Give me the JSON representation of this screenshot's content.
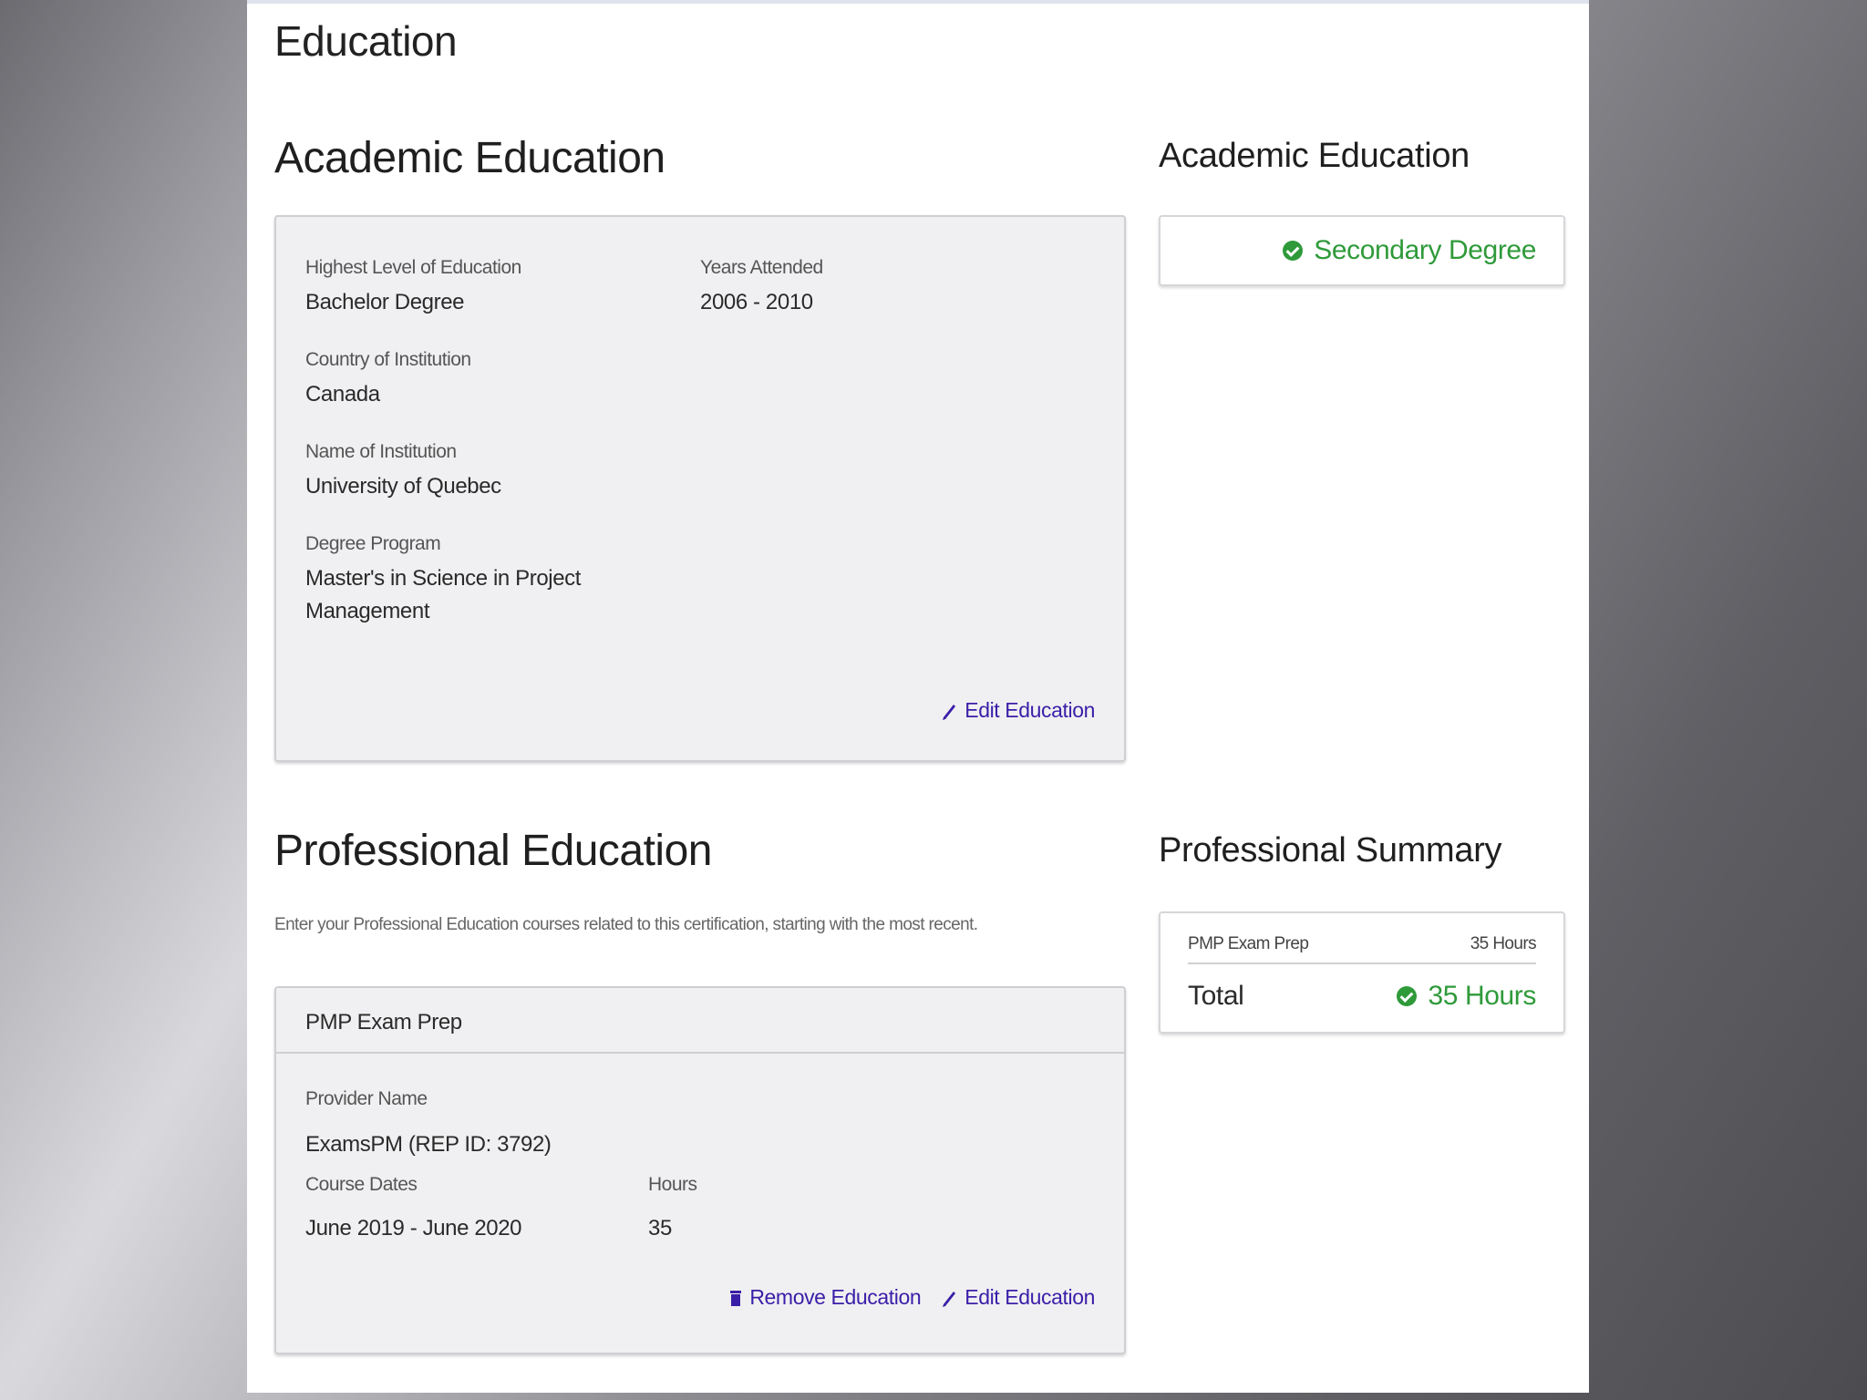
{
  "page": {
    "title": "Education"
  },
  "academic": {
    "heading": "Academic Education",
    "fields": {
      "highest_level_label": "Highest Level of Education",
      "highest_level_value": "Bachelor Degree",
      "years_label": "Years Attended",
      "years_value": "2006 - 2010",
      "country_label": "Country of Institution",
      "country_value": "Canada",
      "institution_label": "Name of Institution",
      "institution_value": "University of Quebec",
      "degree_label": "Degree Program",
      "degree_value_line1": "Master's in Science in Project",
      "degree_value_line2": "Management"
    },
    "edit_label": "Edit Education"
  },
  "academic_summary": {
    "heading": "Academic Education",
    "status": "Secondary Degree"
  },
  "professional": {
    "heading": "Professional Education",
    "description": "Enter your Professional Education courses related to this certification, starting with the most recent.",
    "course": {
      "title": "PMP Exam Prep",
      "provider_label": "Provider Name",
      "provider_value": "ExamsPM (REP ID: 3792)",
      "dates_label": "Course Dates",
      "dates_value": "June 2019 - June 2020",
      "hours_label": "Hours",
      "hours_value": "35"
    },
    "remove_label": "Remove Education",
    "edit_label": "Edit Education"
  },
  "professional_summary": {
    "heading": "Professional Summary",
    "row_name": "PMP Exam Prep",
    "row_hours": "35 Hours",
    "total_label": "Total",
    "total_value": "35 Hours"
  },
  "colors": {
    "link": "#3b1ea8",
    "success": "#2f9a3a"
  }
}
